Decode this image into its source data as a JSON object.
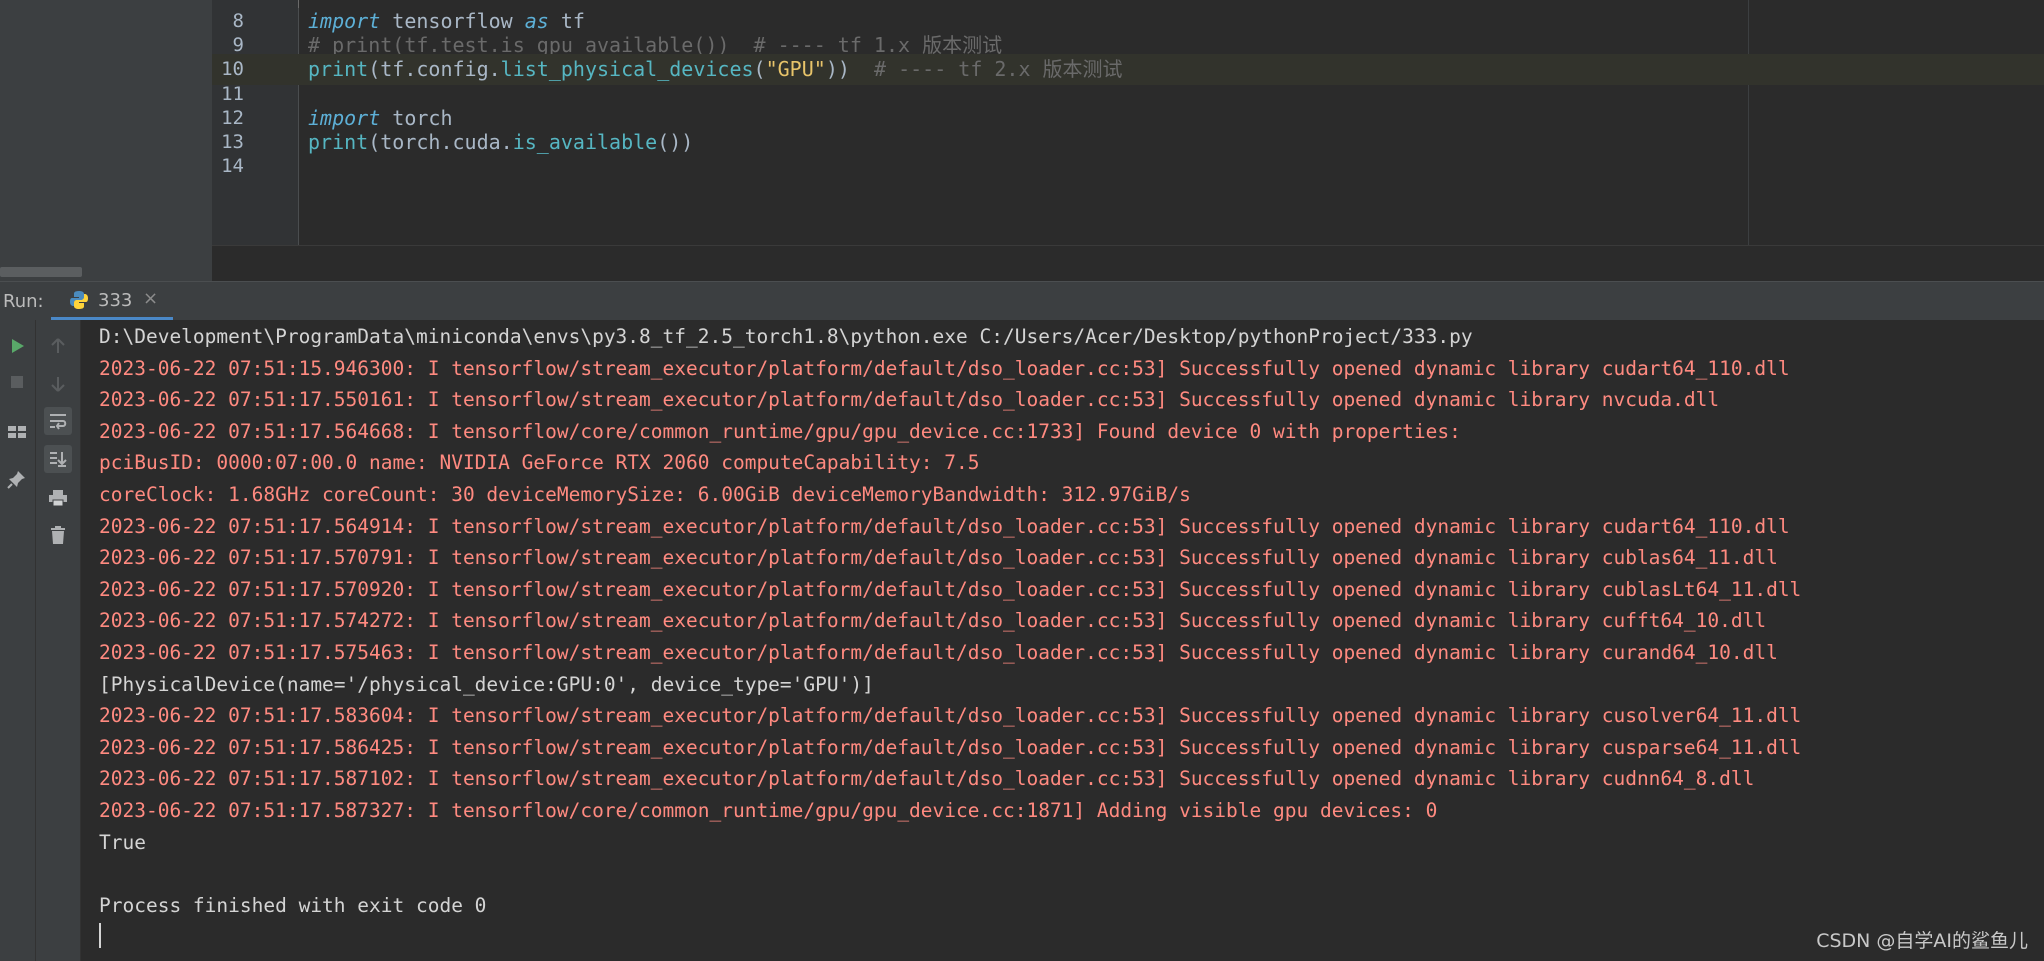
{
  "editor": {
    "lines": [
      {
        "num": "8",
        "parts": [
          {
            "t": "import",
            "c": "kw2"
          },
          {
            "t": " tensorflow ",
            "c": ""
          },
          {
            "t": "as",
            "c": "kw2"
          },
          {
            "t": " tf",
            "c": ""
          }
        ]
      },
      {
        "num": "9",
        "parts": [
          {
            "t": "# print(tf.test.is_gpu_available())  # ---- tf 1.x 版本测试",
            "c": "cm"
          }
        ]
      },
      {
        "num": "10",
        "parts": [
          {
            "t": "print",
            "c": "fn"
          },
          {
            "t": "(tf.config.",
            "c": ""
          },
          {
            "t": "list_physical_devices",
            "c": "fn"
          },
          {
            "t": "(",
            "c": ""
          },
          {
            "t": "\"GPU\"",
            "c": "str"
          },
          {
            "t": "))  ",
            "c": ""
          },
          {
            "t": "# ---- tf 2.x 版本测试",
            "c": "cm"
          }
        ]
      },
      {
        "num": "11",
        "parts": []
      },
      {
        "num": "12",
        "parts": [
          {
            "t": "import",
            "c": "kw2"
          },
          {
            "t": " torch",
            "c": ""
          }
        ]
      },
      {
        "num": "13",
        "parts": [
          {
            "t": "print",
            "c": "fn"
          },
          {
            "t": "(torch.cuda.",
            "c": ""
          },
          {
            "t": "is_available",
            "c": "fn"
          },
          {
            "t": "())",
            "c": ""
          }
        ]
      },
      {
        "num": "14",
        "parts": []
      }
    ],
    "highlighted_line": "10"
  },
  "run": {
    "label": "Run:",
    "tab_label": "333",
    "tab_close": "×"
  },
  "toolbar": {
    "left": [
      "run-icon",
      "stop-icon",
      "layout-icon",
      "pin-icon"
    ],
    "right": [
      "up-arrow-icon",
      "down-arrow-icon",
      "soft-wrap-icon",
      "scroll-to-end-icon",
      "print-icon",
      "trash-icon"
    ]
  },
  "console": {
    "lines": [
      {
        "text": "D:\\Development\\ProgramData\\miniconda\\envs\\py3.8_tf_2.5_torch1.8\\python.exe C:/Users/Acer/Desktop/pythonProject/333.py",
        "kind": "norm"
      },
      {
        "text": "2023-06-22 07:51:15.946300: I tensorflow/stream_executor/platform/default/dso_loader.cc:53] Successfully opened dynamic library cudart64_110.dll",
        "kind": "err"
      },
      {
        "text": "2023-06-22 07:51:17.550161: I tensorflow/stream_executor/platform/default/dso_loader.cc:53] Successfully opened dynamic library nvcuda.dll",
        "kind": "err"
      },
      {
        "text": "2023-06-22 07:51:17.564668: I tensorflow/core/common_runtime/gpu/gpu_device.cc:1733] Found device 0 with properties:",
        "kind": "err"
      },
      {
        "text": "pciBusID: 0000:07:00.0 name: NVIDIA GeForce RTX 2060 computeCapability: 7.5",
        "kind": "err"
      },
      {
        "text": "coreClock: 1.68GHz coreCount: 30 deviceMemorySize: 6.00GiB deviceMemoryBandwidth: 312.97GiB/s",
        "kind": "err"
      },
      {
        "text": "2023-06-22 07:51:17.564914: I tensorflow/stream_executor/platform/default/dso_loader.cc:53] Successfully opened dynamic library cudart64_110.dll",
        "kind": "err"
      },
      {
        "text": "2023-06-22 07:51:17.570791: I tensorflow/stream_executor/platform/default/dso_loader.cc:53] Successfully opened dynamic library cublas64_11.dll",
        "kind": "err"
      },
      {
        "text": "2023-06-22 07:51:17.570920: I tensorflow/stream_executor/platform/default/dso_loader.cc:53] Successfully opened dynamic library cublasLt64_11.dll",
        "kind": "err"
      },
      {
        "text": "2023-06-22 07:51:17.574272: I tensorflow/stream_executor/platform/default/dso_loader.cc:53] Successfully opened dynamic library cufft64_10.dll",
        "kind": "err"
      },
      {
        "text": "2023-06-22 07:51:17.575463: I tensorflow/stream_executor/platform/default/dso_loader.cc:53] Successfully opened dynamic library curand64_10.dll",
        "kind": "err"
      },
      {
        "text": "[PhysicalDevice(name='/physical_device:GPU:0', device_type='GPU')]",
        "kind": "norm"
      },
      {
        "text": "2023-06-22 07:51:17.583604: I tensorflow/stream_executor/platform/default/dso_loader.cc:53] Successfully opened dynamic library cusolver64_11.dll",
        "kind": "err"
      },
      {
        "text": "2023-06-22 07:51:17.586425: I tensorflow/stream_executor/platform/default/dso_loader.cc:53] Successfully opened dynamic library cusparse64_11.dll",
        "kind": "err"
      },
      {
        "text": "2023-06-22 07:51:17.587102: I tensorflow/stream_executor/platform/default/dso_loader.cc:53] Successfully opened dynamic library cudnn64_8.dll",
        "kind": "err"
      },
      {
        "text": "2023-06-22 07:51:17.587327: I tensorflow/core/common_runtime/gpu/gpu_device.cc:1871] Adding visible gpu devices: 0",
        "kind": "err"
      },
      {
        "text": "True",
        "kind": "norm"
      },
      {
        "text": "",
        "kind": "norm"
      },
      {
        "text": "Process finished with exit code 0",
        "kind": "norm"
      }
    ]
  },
  "watermark": "CSDN @自学AI的鲨鱼儿",
  "colors": {
    "error_text": "#ff8a80",
    "normal_text": "#d4d4d4",
    "tab_underline": "#4a88c7"
  }
}
